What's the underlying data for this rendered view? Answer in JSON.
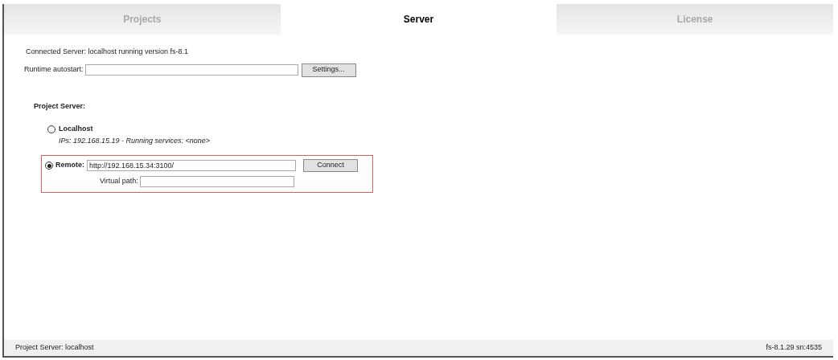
{
  "tabs": [
    {
      "label": "Projects",
      "selected": false
    },
    {
      "label": "Server",
      "selected": true
    },
    {
      "label": "License",
      "selected": false
    }
  ],
  "connected_server": "Connected Server: localhost running version fs-8.1",
  "runtime_autostart": {
    "label": "Runtime autostart:",
    "button": "Settings..."
  },
  "project_server": {
    "heading": "Project Server:",
    "options": [
      {
        "kind": "local",
        "label": "Localhost",
        "selected": false,
        "detail": "IPs: 192.168.15.19 - Running services: <none>"
      },
      {
        "kind": "remote",
        "label": "Remote:",
        "selected": true,
        "url": "http://192.168.15.34:3100/",
        "button": "Connect",
        "path_label": "Virtual path:"
      }
    ]
  },
  "status_bar": {
    "left": "Project Server: localhost",
    "right": "fs-8.1.29 sn:4535"
  }
}
